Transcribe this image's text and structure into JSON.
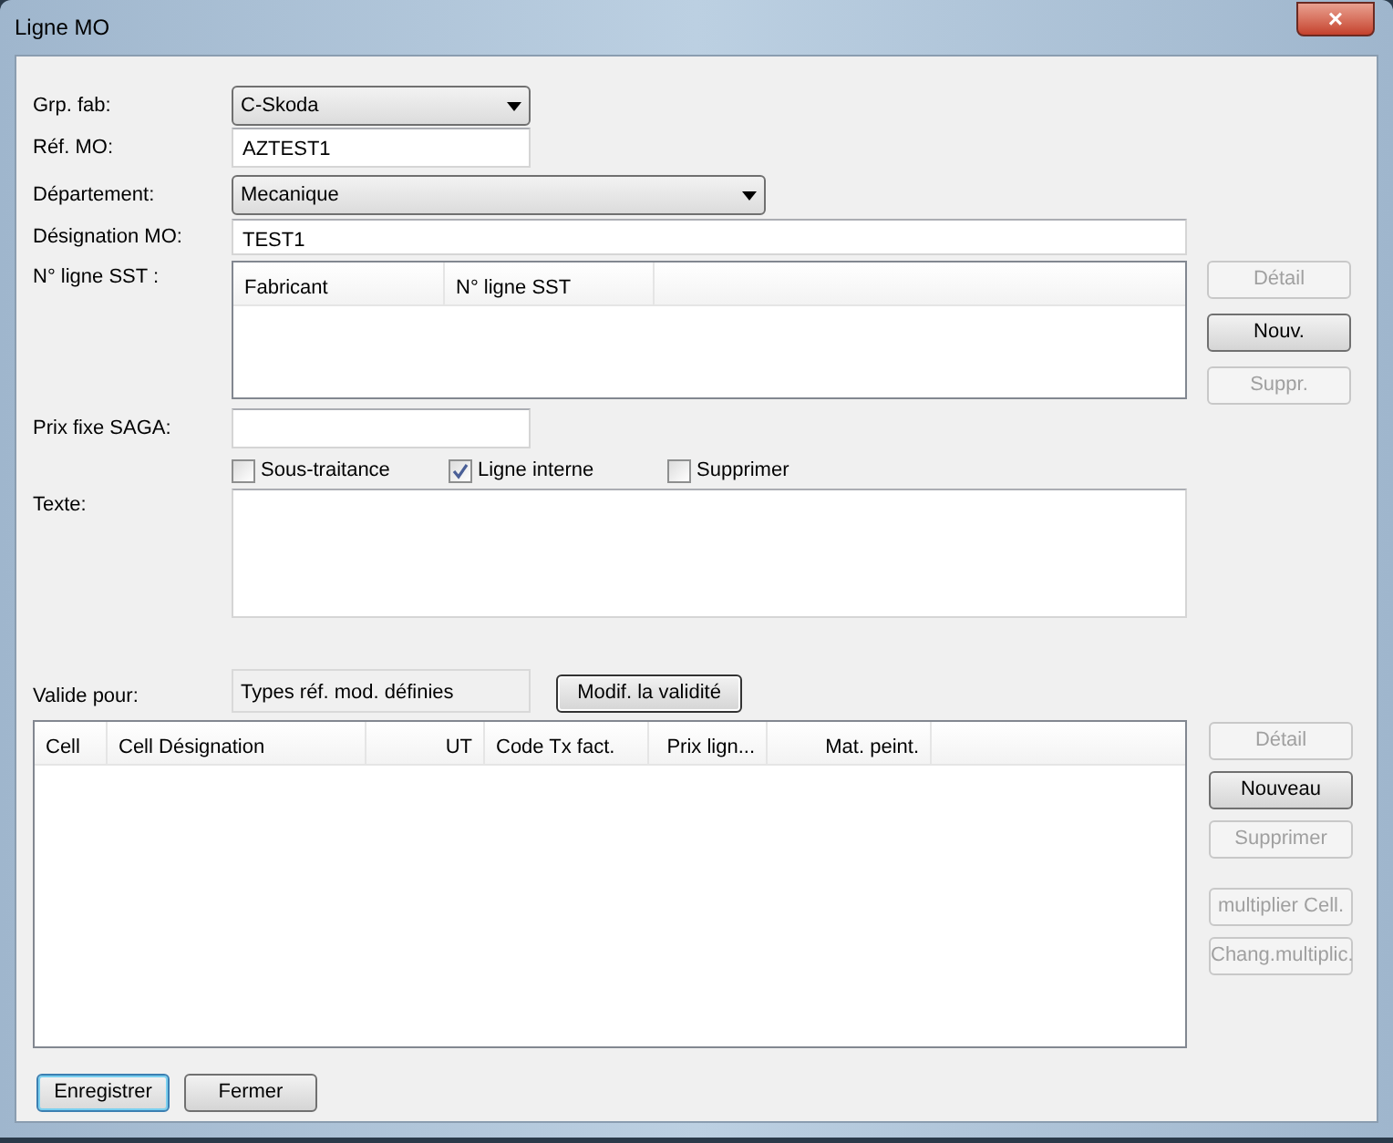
{
  "window": {
    "title": "Ligne MO",
    "close_label": "×"
  },
  "form": {
    "grp_fab": {
      "label": "Grp. fab:",
      "value": "C-Skoda"
    },
    "ref_mo": {
      "label": "Réf. MO:",
      "value": "AZTEST1"
    },
    "departement": {
      "label": "Département:",
      "value": "Mecanique"
    },
    "designation": {
      "label": "Désignation MO:",
      "value": "TEST1"
    },
    "sst": {
      "label": "N° ligne SST :",
      "columns": [
        {
          "label": "Fabricant"
        },
        {
          "label": "N° ligne SST"
        }
      ],
      "buttons": [
        {
          "label": "Détail",
          "disabled": true
        },
        {
          "label": "Nouv.",
          "disabled": false
        },
        {
          "label": "Suppr.",
          "disabled": true
        }
      ]
    },
    "prix_fixe": {
      "label": "Prix fixe SAGA:"
    },
    "checkboxes": [
      {
        "label": "Sous-traitance",
        "checked": false
      },
      {
        "label": "Ligne interne",
        "checked": true
      },
      {
        "label": "Supprimer",
        "checked": false
      }
    ],
    "texte": {
      "label": "Texte:"
    },
    "valide_pour": {
      "label": "Valide pour:",
      "value": "Types réf. mod. définies",
      "button": "Modif. la validité"
    }
  },
  "table": {
    "columns": [
      {
        "label": "Cell"
      },
      {
        "label": "Cell Désignation"
      },
      {
        "label": "UT"
      },
      {
        "label": "Code Tx fact."
      },
      {
        "label": "Prix lign..."
      },
      {
        "label": "Mat. peint."
      }
    ],
    "buttons": [
      {
        "label": "Détail",
        "disabled": true
      },
      {
        "label": "Nouveau",
        "disabled": false
      },
      {
        "label": "Supprimer",
        "disabled": true
      },
      {
        "label": "multiplier Cell.",
        "disabled": true
      },
      {
        "label": "Chang.multiplic.",
        "disabled": true
      }
    ]
  },
  "footer": [
    {
      "label": "Enregistrer",
      "default": true
    },
    {
      "label": "Fermer",
      "default": false
    }
  ]
}
